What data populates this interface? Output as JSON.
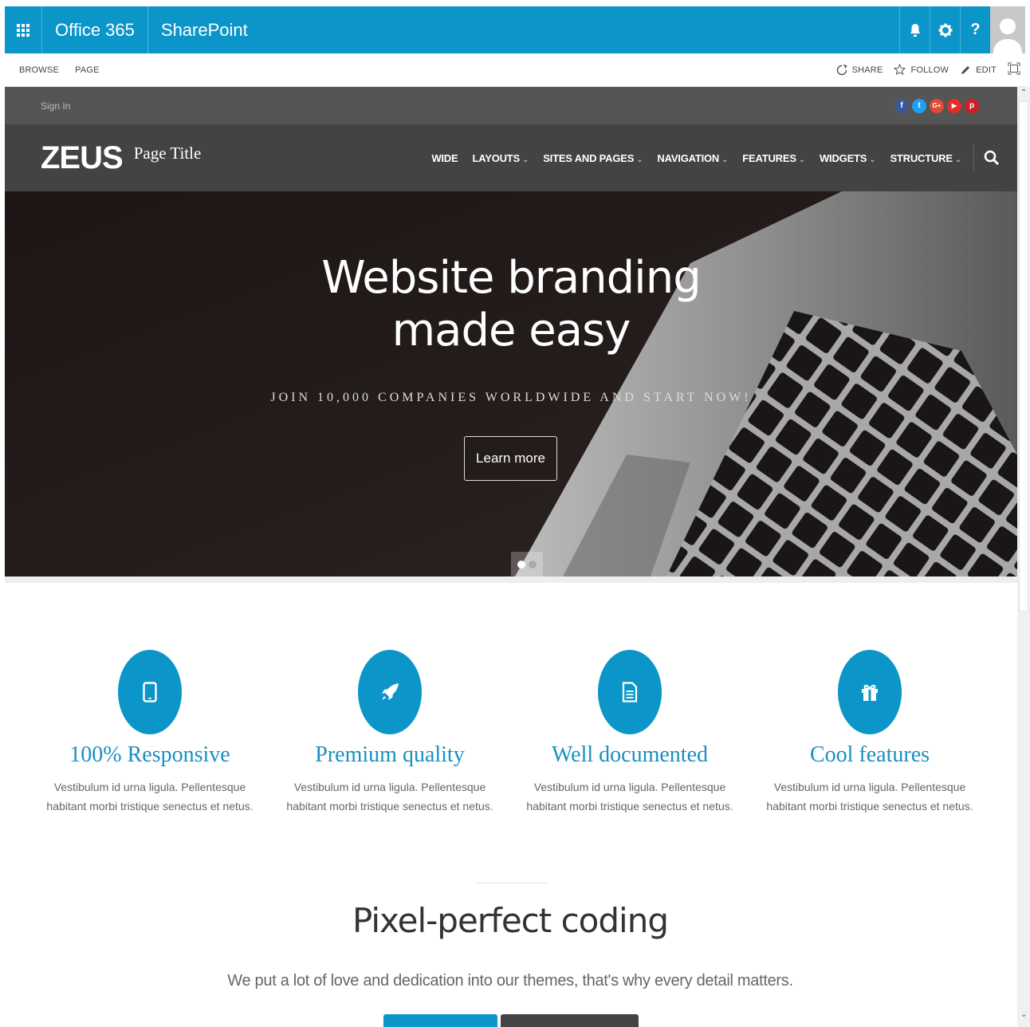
{
  "suitebar": {
    "office_label": "Office 365",
    "app_label": "SharePoint",
    "help_label": "?"
  },
  "ribbon": {
    "tabs": [
      "BROWSE",
      "PAGE"
    ],
    "share_label": "SHARE",
    "follow_label": "FOLLOW",
    "edit_label": "EDIT"
  },
  "topbar": {
    "signin_label": "Sign In",
    "social": [
      {
        "name": "facebook",
        "glyph": "f",
        "color": "#3b5998"
      },
      {
        "name": "twitter",
        "glyph": "t",
        "color": "#1da1f2"
      },
      {
        "name": "google-plus",
        "glyph": "G+",
        "color": "#dd4b39"
      },
      {
        "name": "youtube",
        "glyph": "▶",
        "color": "#e52d27"
      },
      {
        "name": "pinterest",
        "glyph": "p",
        "color": "#cb2027"
      }
    ]
  },
  "nav": {
    "logo": "ZEUS",
    "page_title": "Page Title",
    "items": [
      "WIDE",
      "LAYOUTS",
      "SITES AND PAGES",
      "NAVIGATION",
      "FEATURES",
      "WIDGETS",
      "STRUCTURE"
    ]
  },
  "hero": {
    "title_line1": "Website branding",
    "title_line2": "made easy",
    "subtitle": "JOIN 10,000 COMPANIES WORLDWIDE AND START NOW!",
    "button_label": "Learn more",
    "slides_total": 2,
    "slide_active": 1
  },
  "features": [
    {
      "icon": "tablet-icon",
      "title": "100% Responsive",
      "text1": "Vestibulum id urna ligula. Pellentesque",
      "text2": "habitant morbi tristique senectus et netus."
    },
    {
      "icon": "rocket-icon",
      "title": "Premium quality",
      "text1": "Vestibulum id urna ligula. Pellentesque",
      "text2": "habitant morbi tristique senectus et netus."
    },
    {
      "icon": "document-icon",
      "title": "Well documented",
      "text1": "Vestibulum id urna ligula. Pellentesque",
      "text2": "habitant morbi tristique senectus et netus."
    },
    {
      "icon": "gift-icon",
      "title": "Cool features",
      "text1": "Vestibulum id urna ligula. Pellentesque",
      "text2": "habitant morbi tristique senectus et netus."
    }
  ],
  "section": {
    "title": "Pixel-perfect coding",
    "subtitle": "We put a lot of love and dedication into our themes, that's why every detail matters."
  },
  "colors": {
    "accent": "#0b95c9",
    "nav_bg": "#434343",
    "topbar_bg": "#555555"
  }
}
